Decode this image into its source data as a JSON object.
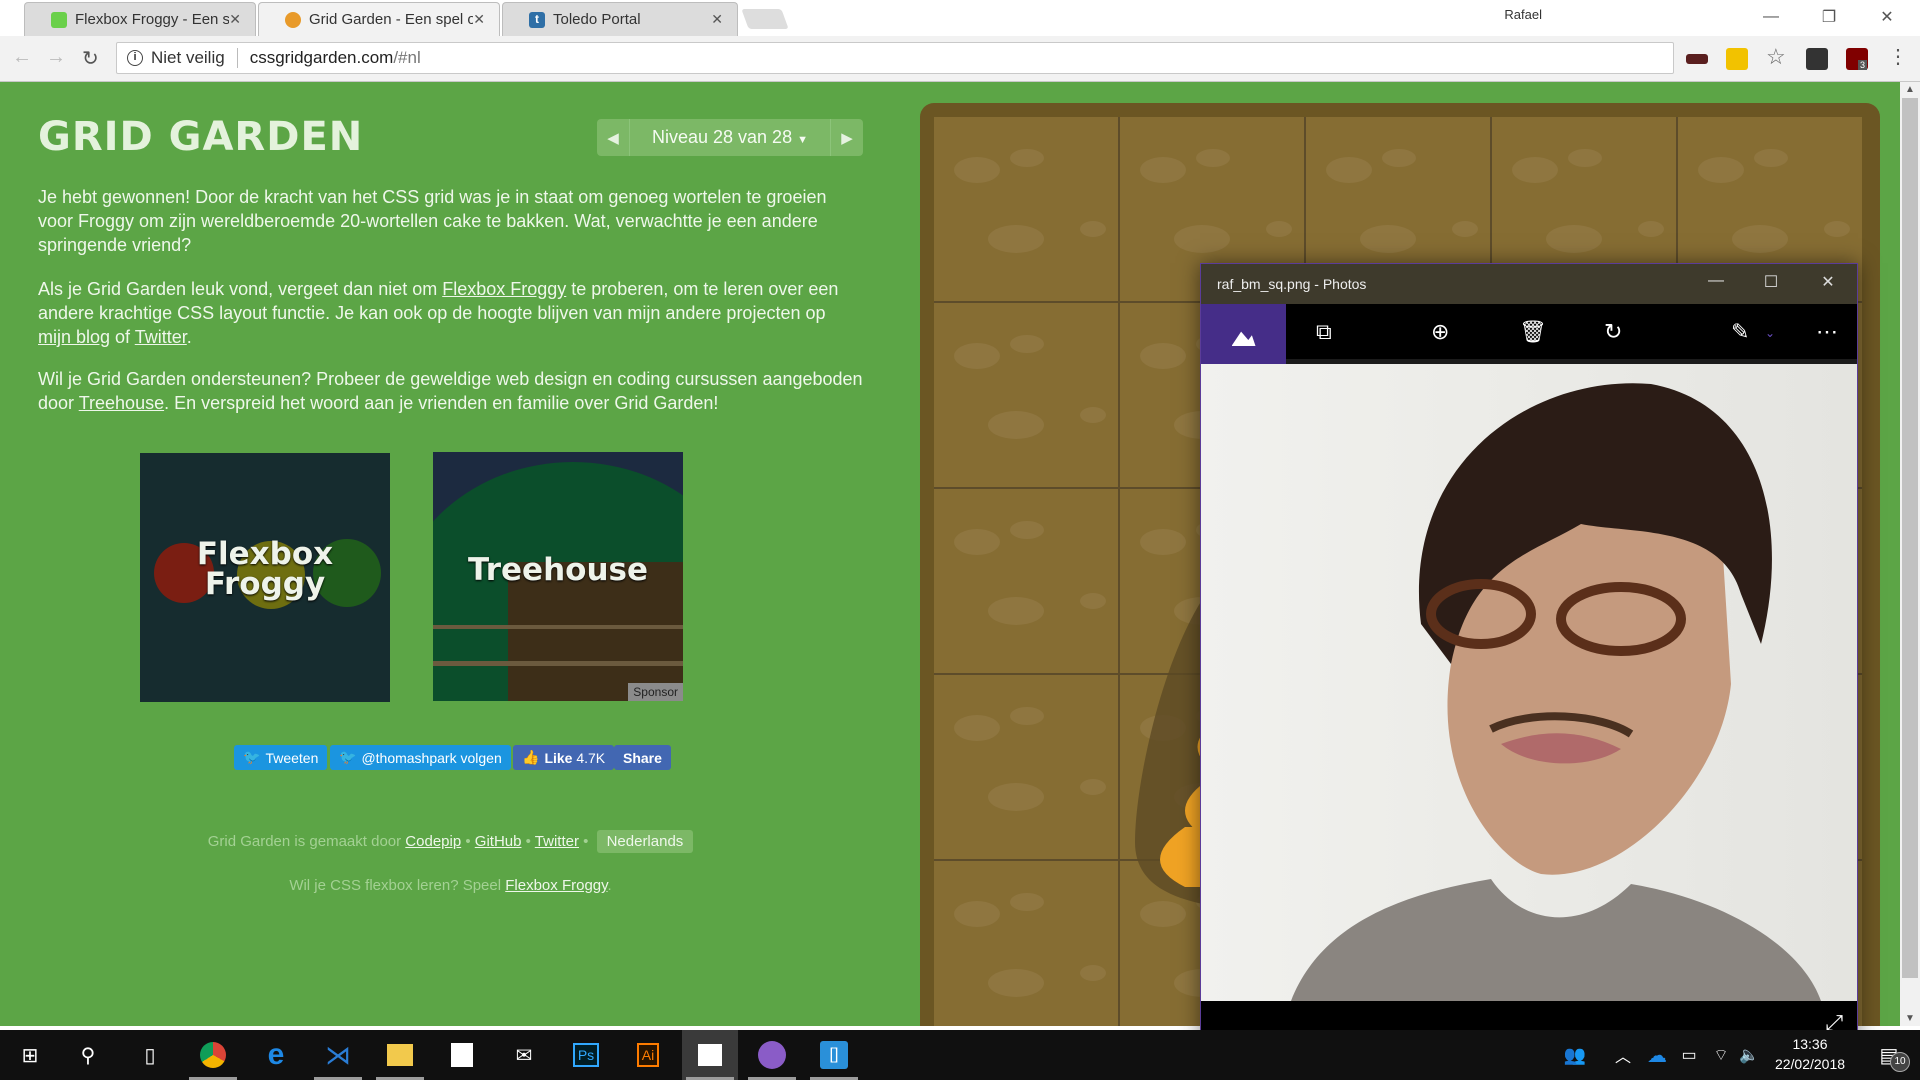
{
  "browser": {
    "tabs": [
      {
        "title": "Flexbox Froggy - Een spel om CSS flexbox te leren",
        "icon": "frog-icon",
        "active": false
      },
      {
        "title": "Grid Garden - Een spel om CSS grid te leren",
        "icon": "carrot-icon",
        "active": true
      },
      {
        "title": "Toledo Portal",
        "icon": "toledo-t-icon",
        "active": false
      }
    ],
    "user": "Rafael",
    "security_label": "Niet veilig",
    "url_host": "cssgridgarden.com",
    "url_path": "/#nl",
    "extensions": [
      {
        "name": "incognito-mask-extension",
        "color": "#5a1f1f"
      },
      {
        "name": "lastpass-extension",
        "color": "#f2c200"
      },
      {
        "name": "bookmark-star",
        "color": "#666666"
      },
      {
        "name": "tabs-extension",
        "color": "#333333"
      },
      {
        "name": "ublock-origin-extension",
        "color": "#800000",
        "badge": "3"
      }
    ]
  },
  "page": {
    "title": "GRID GARDEN",
    "level_label": "Niveau 28 van 28",
    "level_current": 28,
    "level_total": 28,
    "paragraph1": "Je hebt gewonnen! Door de kracht van het CSS grid was je in staat om genoeg wortelen te groeien voor Froggy om zijn wereldberoemde 20-wortellen cake te bakken. Wat, verwachtte je een andere springende vriend?",
    "paragraph2": {
      "pre": "Als je Grid Garden leuk vond, vergeet dan niet om ",
      "link1": "Flexbox Froggy",
      "mid": " te proberen, om te leren over een andere krachtige CSS layout functie. Je kan ook op de hoogte blijven van mijn andere projecten op ",
      "link2": "mijn blog",
      "of": " of ",
      "link3": "Twitter",
      "end": "."
    },
    "paragraph3": {
      "pre": "Wil je Grid Garden ondersteunen? Probeer de geweldige web design en coding cursussen aangeboden door ",
      "link": "Treehouse",
      "end": ". En verspreid het woord aan je vrienden en familie over Grid Garden!"
    },
    "cards": {
      "froggy_line1": "Flexbox",
      "froggy_line2": "Froggy",
      "treehouse": "Treehouse",
      "sponsor": "Sponsor"
    },
    "social": {
      "tweet": "Tweeten",
      "follow": "@thomashpark volgen",
      "like": "Like",
      "like_count": "4.7K",
      "share": "Share"
    },
    "footer": {
      "made_by": "Grid Garden is gemaakt door ",
      "codepip": "Codepip",
      "github": "GitHub",
      "twitter": "Twitter",
      "bullet": " • ",
      "language": "Nederlands",
      "flexbox_pre": "Wil je CSS flexbox leren? Speel ",
      "flexbox_link": "Flexbox Froggy",
      "flexbox_end": "."
    }
  },
  "photos": {
    "window_title": "raf_bm_sq.png - Photos",
    "toolbar": [
      "collection-icon",
      "slideshow-icon",
      "zoom-in-icon",
      "delete-icon",
      "rotate-icon",
      "edit-icon",
      "more-icon"
    ],
    "accent": "#452d88"
  },
  "taskbar": {
    "apps": [
      "start",
      "search",
      "task-view",
      "chrome",
      "edge",
      "vscode",
      "file-explorer",
      "store",
      "mail",
      "photoshop",
      "illustrator",
      "photos",
      "github-desktop",
      "brackets"
    ],
    "time": "13:36",
    "date": "22/02/2018",
    "notification_count": "10"
  }
}
